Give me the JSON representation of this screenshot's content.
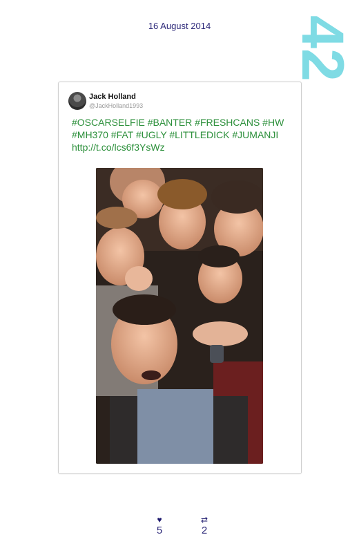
{
  "date": "16 August 2014",
  "page_number": "42",
  "tweet": {
    "author_name": "Jack Holland",
    "author_handle": "@JackHolland1993",
    "text": "#OSCARSELFIE #BANTER #FRESHCANS #HW #MH370 #FAT #UGLY #LITTLEDICK #JUMANJI",
    "link": "http://t.co/lcs6f3YsWz"
  },
  "stats": {
    "likes": "5",
    "retweets": "2",
    "like_icon": "heart-icon",
    "retweet_icon": "retweet-icon"
  }
}
